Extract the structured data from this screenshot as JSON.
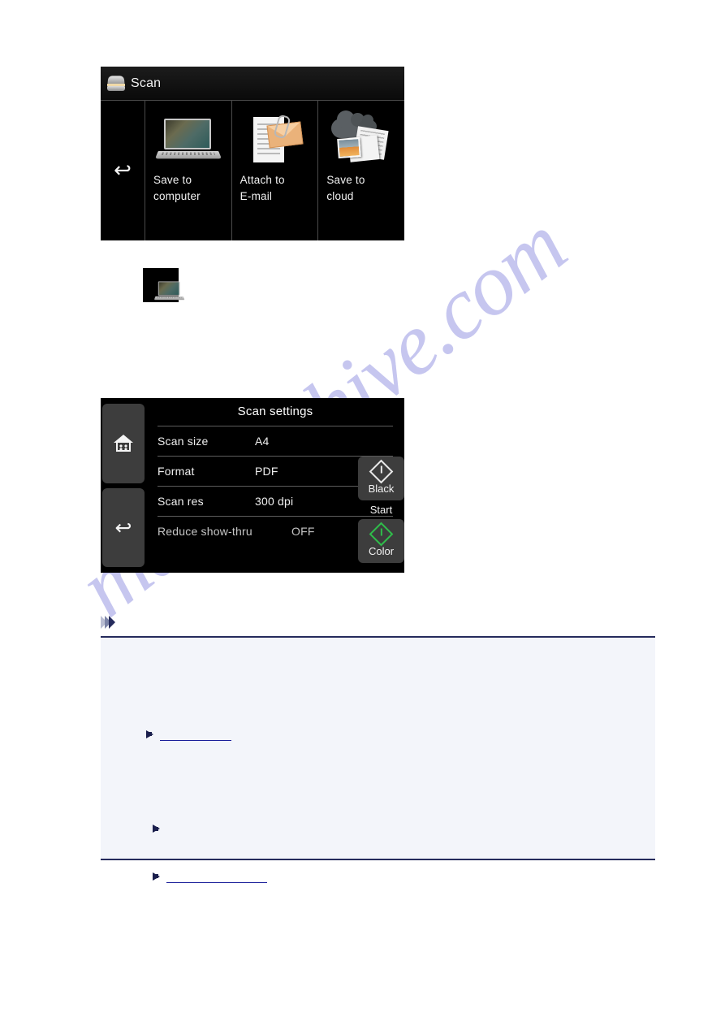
{
  "page": {
    "watermark_text": "manualshive.com",
    "background_color": "#ffffff"
  },
  "scan_menu_panel": {
    "title": "Scan",
    "title_icon": "scanner-icon",
    "back_button_glyph": "↩",
    "tiles": [
      {
        "label_line1": "Save to",
        "label_line2": "computer",
        "icon": "laptop-icon"
      },
      {
        "label_line1": "Attach to",
        "label_line2": "E-mail",
        "icon": "email-attachment-icon"
      },
      {
        "label_line1": "Save to",
        "label_line2": "cloud",
        "icon": "cloud-upload-icon"
      }
    ]
  },
  "laptop_thumbnail": {
    "icon": "laptop-icon"
  },
  "scan_settings_panel": {
    "title": "Scan settings",
    "home_button_icon": "home-icon",
    "back_button_icon": "back-arrow-icon",
    "back_button_glyph": "↩",
    "rows": [
      {
        "label": "Scan size",
        "value": "A4"
      },
      {
        "label": "Format",
        "value": "PDF"
      },
      {
        "label": "Scan res",
        "value": "300 dpi"
      },
      {
        "label": "Reduce show-thru",
        "value": "OFF"
      }
    ],
    "start_keys": {
      "black_label": "Black",
      "start_label": "Start",
      "color_label": "Color",
      "black_accent": "#e9e9e9",
      "color_accent": "#2fbd4a"
    }
  },
  "note_block": {
    "header_icon": "triple-chevron-icon",
    "accent_color": "#252b5c",
    "background_color": "#f3f5fa",
    "link_color": "#1a1f9a",
    "lines": [
      {
        "bullet": "arrow-bullet",
        "link": "short"
      },
      {
        "bullet": "arrow-bullet",
        "link": "none"
      },
      {
        "bullet": "arrow-bullet",
        "link": "long"
      }
    ]
  }
}
